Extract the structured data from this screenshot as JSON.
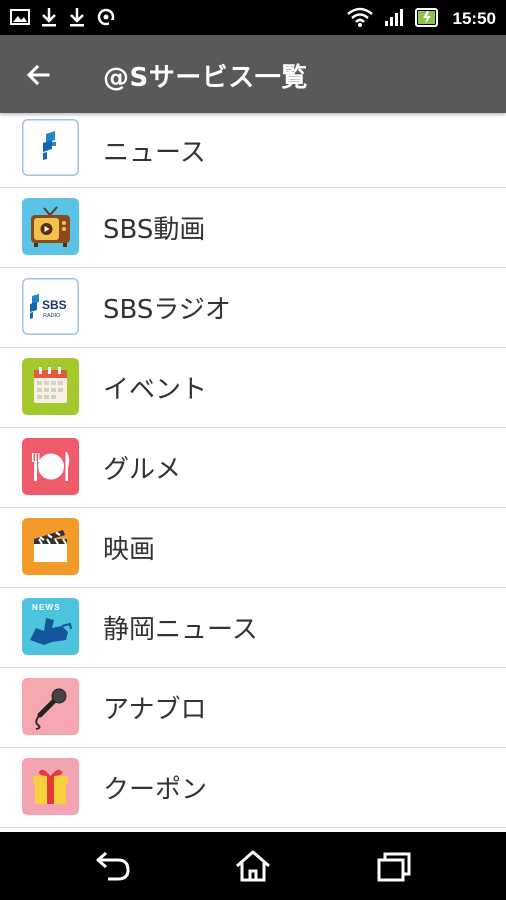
{
  "status_bar": {
    "time": "15:50",
    "left_icons": [
      "image-icon",
      "download-icon",
      "download-icon",
      "sync-icon"
    ],
    "right_icons": [
      "wifi-icon",
      "signal-icon",
      "battery-charging-icon"
    ]
  },
  "app_bar": {
    "back_icon": "arrow-back-icon",
    "title": "@Sサービス一覧"
  },
  "services": [
    {
      "label": "ニュース",
      "icon": "news-logo-icon"
    },
    {
      "label": "SBS動画",
      "icon": "tv-icon"
    },
    {
      "label": "SBSラジオ",
      "icon": "sbs-radio-icon",
      "icon_text": "SBS",
      "icon_subtext": "RADIO"
    },
    {
      "label": "イベント",
      "icon": "calendar-icon"
    },
    {
      "label": "グルメ",
      "icon": "plate-cutlery-icon"
    },
    {
      "label": "映画",
      "icon": "clapperboard-icon"
    },
    {
      "label": "静岡ニュース",
      "icon": "shizuoka-news-icon",
      "icon_text": "NEWS"
    },
    {
      "label": "アナブロ",
      "icon": "microphone-icon"
    },
    {
      "label": "クーポン",
      "icon": "gift-icon"
    }
  ],
  "nav_bar": {
    "buttons": [
      "back-nav-icon",
      "home-icon",
      "recents-icon"
    ]
  },
  "colors": {
    "app_bar": "#595959",
    "status_bar": "#000000",
    "divider": "#dcdcdc"
  }
}
